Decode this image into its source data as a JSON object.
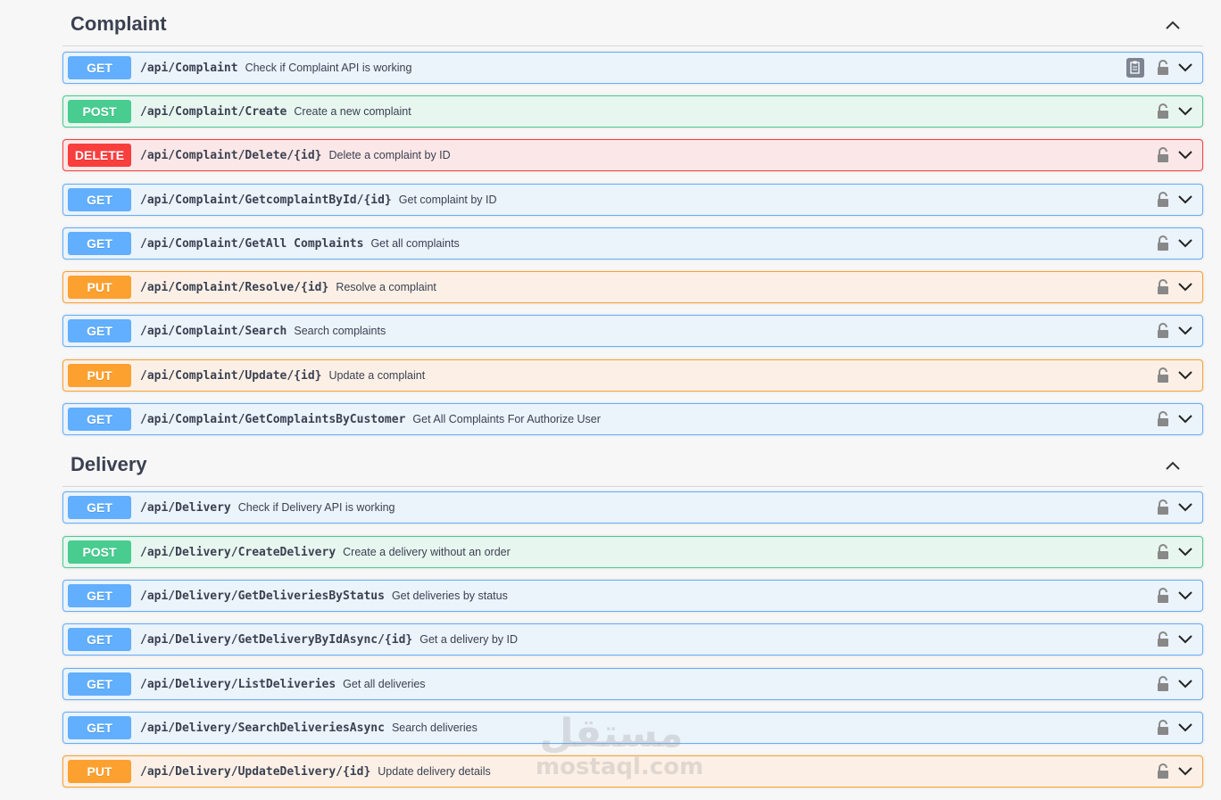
{
  "sections": [
    {
      "title": "Complaint",
      "operations": [
        {
          "method": "GET",
          "path": "/api/Complaint",
          "summary": "Check if Complaint API is working",
          "copy": true
        },
        {
          "method": "POST",
          "path": "/api/Complaint/Create",
          "summary": "Create a new complaint"
        },
        {
          "method": "DELETE",
          "path": "/api/Complaint/Delete/{id}",
          "summary": "Delete a complaint by ID"
        },
        {
          "method": "GET",
          "path": "/api/Complaint/GetcomplaintById/{id}",
          "summary": "Get complaint by ID"
        },
        {
          "method": "GET",
          "path": "/api/Complaint/GetAll Complaints",
          "summary": "Get all complaints"
        },
        {
          "method": "PUT",
          "path": "/api/Complaint/Resolve/{id}",
          "summary": "Resolve a complaint"
        },
        {
          "method": "GET",
          "path": "/api/Complaint/Search",
          "summary": "Search complaints"
        },
        {
          "method": "PUT",
          "path": "/api/Complaint/Update/{id}",
          "summary": "Update a complaint"
        },
        {
          "method": "GET",
          "path": "/api/Complaint/GetComplaintsByCustomer",
          "summary": "Get All Complaints For Authorize User"
        }
      ]
    },
    {
      "title": "Delivery",
      "operations": [
        {
          "method": "GET",
          "path": "/api/Delivery",
          "summary": "Check if Delivery API is working"
        },
        {
          "method": "POST",
          "path": "/api/Delivery/CreateDelivery",
          "summary": "Create a delivery without an order"
        },
        {
          "method": "GET",
          "path": "/api/Delivery/GetDeliveriesByStatus",
          "summary": "Get deliveries by status"
        },
        {
          "method": "GET",
          "path": "/api/Delivery/GetDeliveryByIdAsync/{id}",
          "summary": "Get a delivery by ID"
        },
        {
          "method": "GET",
          "path": "/api/Delivery/ListDeliveries",
          "summary": "Get all deliveries"
        },
        {
          "method": "GET",
          "path": "/api/Delivery/SearchDeliveriesAsync",
          "summary": "Search deliveries"
        },
        {
          "method": "PUT",
          "path": "/api/Delivery/UpdateDelivery/{id}",
          "summary": "Update delivery details"
        }
      ]
    }
  ],
  "icons": {
    "lock": "lock-icon",
    "expand": "chevron-down-icon",
    "collapse": "chevron-up-icon",
    "copy": "copy-to-clipboard-icon"
  },
  "colors": {
    "get": "#61affe",
    "post": "#49cc90",
    "delete": "#f93e3e",
    "put": "#fca130",
    "text": "#3b4151"
  },
  "watermark": {
    "arabic": "مستقل",
    "latin": "mostaql.com"
  }
}
